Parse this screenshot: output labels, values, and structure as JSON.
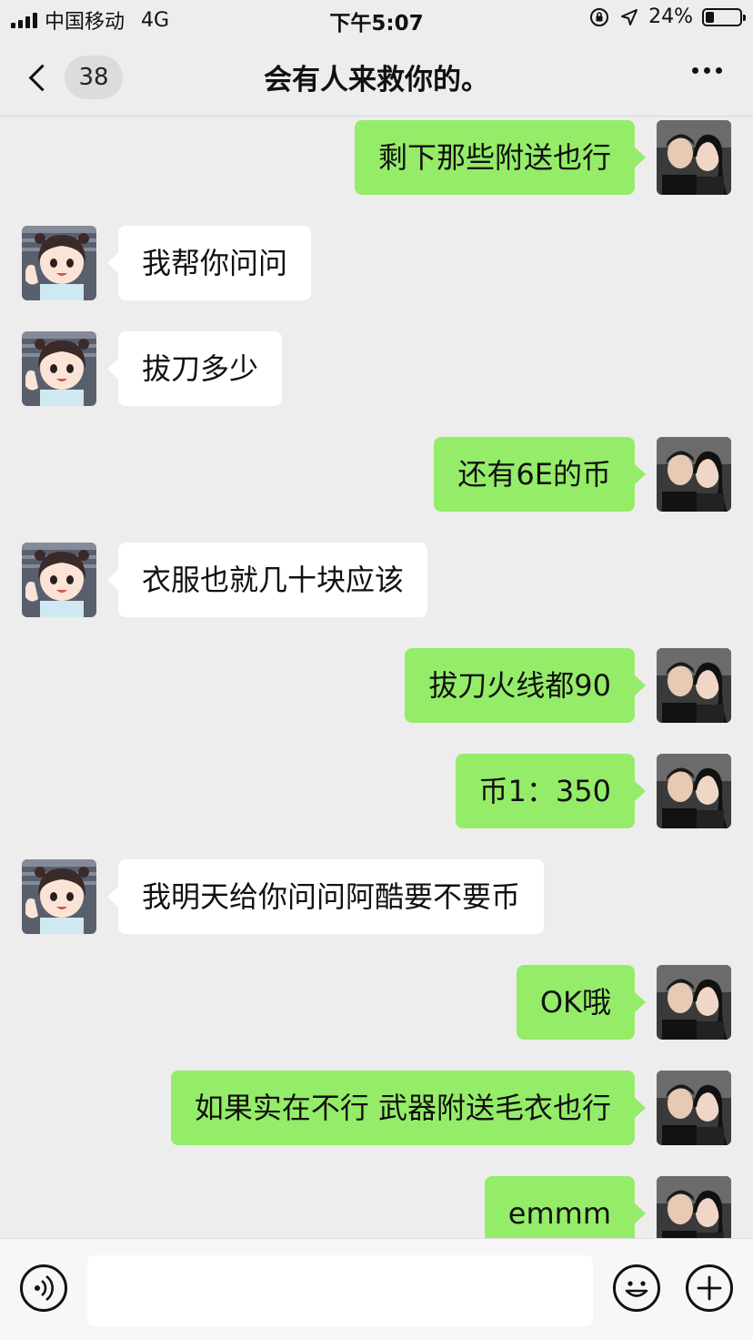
{
  "status_bar": {
    "carrier": "中国移动",
    "network": "4G",
    "time": "下午5:07",
    "battery": "24%",
    "battery_level": 0.24
  },
  "header": {
    "back_count": "38",
    "title": "会有人来救你的。",
    "more_icon": "more-dots-icon"
  },
  "messages": [
    {
      "from": "me",
      "text": "剩下那些附送也行"
    },
    {
      "from": "them",
      "text": "我帮你问问"
    },
    {
      "from": "them",
      "text": "拔刀多少"
    },
    {
      "from": "me",
      "text": "还有6E的币"
    },
    {
      "from": "them",
      "text": "衣服也就几十块应该"
    },
    {
      "from": "me",
      "text": "拔刀火线都90"
    },
    {
      "from": "me",
      "text": "币1：350"
    },
    {
      "from": "them",
      "text": "我明天给你问问阿酷要不要币"
    },
    {
      "from": "me",
      "text": "OK哦"
    },
    {
      "from": "me",
      "text": "如果实在不行 武器附送毛衣也行"
    },
    {
      "from": "me",
      "text": "emmm"
    }
  ],
  "input_bar": {
    "voice_icon": "voice-icon",
    "emoji_icon": "emoji-icon",
    "plus_icon": "plus-icon",
    "value": ""
  },
  "colors": {
    "my_bubble": "#95ec69",
    "their_bubble": "#ffffff",
    "background": "#ededed"
  }
}
